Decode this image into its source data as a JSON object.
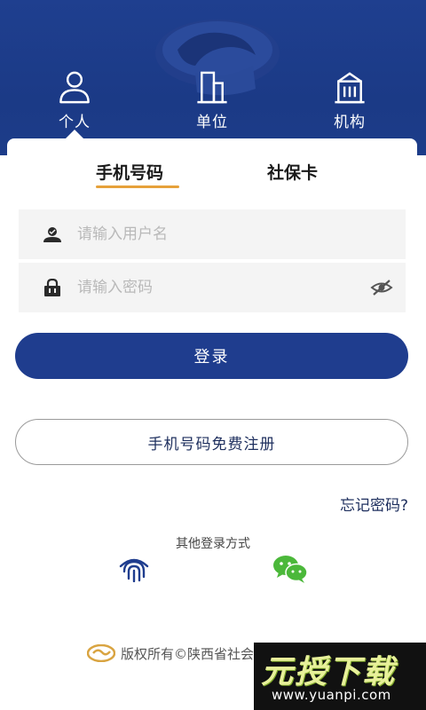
{
  "role_tabs": [
    {
      "label": "个人",
      "icon": "person-icon",
      "selected": true
    },
    {
      "label": "单位",
      "icon": "building-icon"
    },
    {
      "label": "机构",
      "icon": "institution-icon"
    }
  ],
  "login_tabs": [
    {
      "label": "手机号码",
      "selected": true
    },
    {
      "label": "社保卡"
    }
  ],
  "username": {
    "placeholder": "请输入用户名",
    "icon": "user-icon"
  },
  "password": {
    "placeholder": "请输入密码",
    "icon": "lock-icon",
    "toggle_icon": "eye-off-icon"
  },
  "login_button": "登录",
  "register_button": "手机号码免费注册",
  "forgot_link": "忘记密码?",
  "other_login": {
    "title": "其他登录方式",
    "methods": [
      {
        "name": "fingerprint",
        "icon": "fingerprint-icon"
      },
      {
        "name": "wechat",
        "icon": "wechat-icon"
      }
    ]
  },
  "footer": {
    "text": "版权所有©陕西省社会保障局",
    "icon": "si-logo"
  },
  "watermark": {
    "main": "元授下载",
    "url": "www.yuanpi.com"
  },
  "colors": {
    "primary": "#1f3d8e",
    "accent": "#e6a13a",
    "wechat": "#4bb83a"
  }
}
